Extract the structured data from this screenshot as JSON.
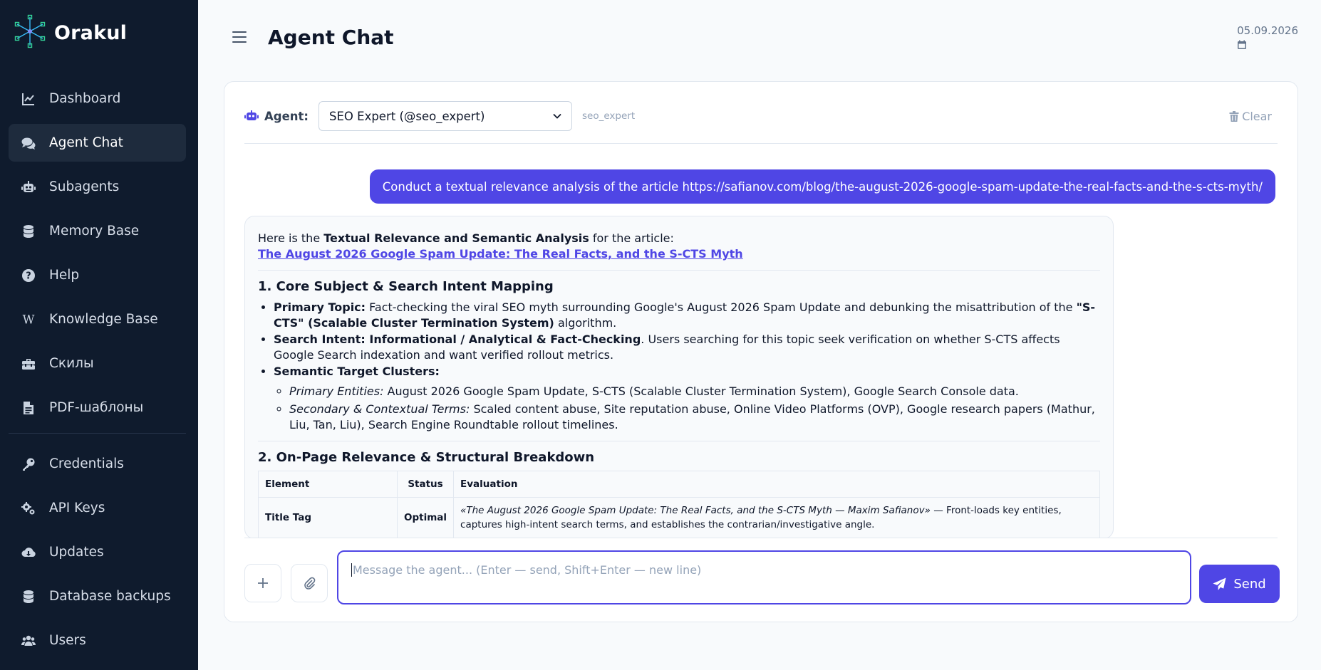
{
  "app": {
    "name": "Orakul"
  },
  "sidebar": {
    "items": [
      {
        "label": "Dashboard",
        "icon": "chart-line-icon"
      },
      {
        "label": "Agent Chat",
        "icon": "comments-icon",
        "active": true
      },
      {
        "label": "Subagents",
        "icon": "robot-icon"
      },
      {
        "label": "Memory Base",
        "icon": "database-icon"
      },
      {
        "label": "Help",
        "icon": "question-circle-icon"
      },
      {
        "label": "Knowledge Base",
        "icon": "wikipedia-icon"
      },
      {
        "label": "Скилы",
        "icon": "toolbox-icon"
      },
      {
        "label": "PDF-шаблоны",
        "icon": "file-pdf-icon"
      }
    ],
    "items2": [
      {
        "label": "Credentials",
        "icon": "key-icon"
      },
      {
        "label": "API Keys",
        "icon": "cogs-icon"
      },
      {
        "label": "Updates",
        "icon": "cloud-download-icon"
      },
      {
        "label": "Database backups",
        "icon": "database-icon"
      },
      {
        "label": "Users",
        "icon": "users-icon"
      }
    ]
  },
  "header": {
    "title": "Agent Chat",
    "date": "05.09.2026"
  },
  "chat": {
    "agent_label": "Agent:",
    "agent_selected": "SEO Expert (@seo_expert)",
    "agent_handle": "seo_expert",
    "clear_label": "Clear",
    "user_message": "Conduct a textual relevance analysis of the article https://safianov.com/blog/the-august-2026-google-spam-update-the-real-facts-and-the-s-cts-myth/",
    "bot": {
      "intro_pre": "Here is the ",
      "intro_bold": "Textual Relevance and Semantic Analysis",
      "intro_post": " for the article:",
      "article_link": "The August 2026 Google Spam Update: The Real Facts, and the S-CTS Myth",
      "section1_title": "1. Core Subject & Search Intent Mapping",
      "primary_topic_label": "Primary Topic:",
      "primary_topic_text": " Fact-checking the viral SEO myth surrounding Google's August 2026 Spam Update and debunking the misattribution of the ",
      "primary_topic_bold": "\"S-CTS\" (Scalable Cluster Termination System)",
      "primary_topic_end": " algorithm.",
      "search_intent_label": "Search Intent: Informational / Analytical & Fact-Checking",
      "search_intent_text": ". Users searching for this topic seek verification on whether S-CTS affects Google Search indexation and want verified rollout metrics.",
      "clusters_label": "Semantic Target Clusters:",
      "primary_entities_label": "Primary Entities:",
      "primary_entities_text": " August 2026 Google Spam Update, S-CTS (Scalable Cluster Termination System), Google Search Console data.",
      "secondary_label": "Secondary & Contextual Terms:",
      "secondary_text": " Scaled content abuse, Site reputation abuse, Online Video Platforms (OVP), Google research papers (Mathur, Liu, Tan, Liu), Search Engine Roundtable rollout timelines.",
      "section2_title": "2. On-Page Relevance & Structural Breakdown",
      "table": {
        "headers": [
          "Element",
          "Status",
          "Evaluation"
        ],
        "rows": [
          {
            "element": "Title Tag",
            "status": "Optimal",
            "eval_italic": "«The August 2026 Google Spam Update: The Real Facts, and the S-CTS Myth — Maxim Safianov»",
            "eval_text": " — Front-loads key entities, captures high-intent search terms, and establishes the contrarian/investigative angle."
          }
        ]
      }
    },
    "input_placeholder": "Message the agent... (Enter — send, Shift+Enter — new line)",
    "send_label": "Send"
  },
  "colors": {
    "sidebar_bg": "#0f1b2d",
    "accent": "#4f46e5",
    "page_bg": "#f8fafc"
  }
}
